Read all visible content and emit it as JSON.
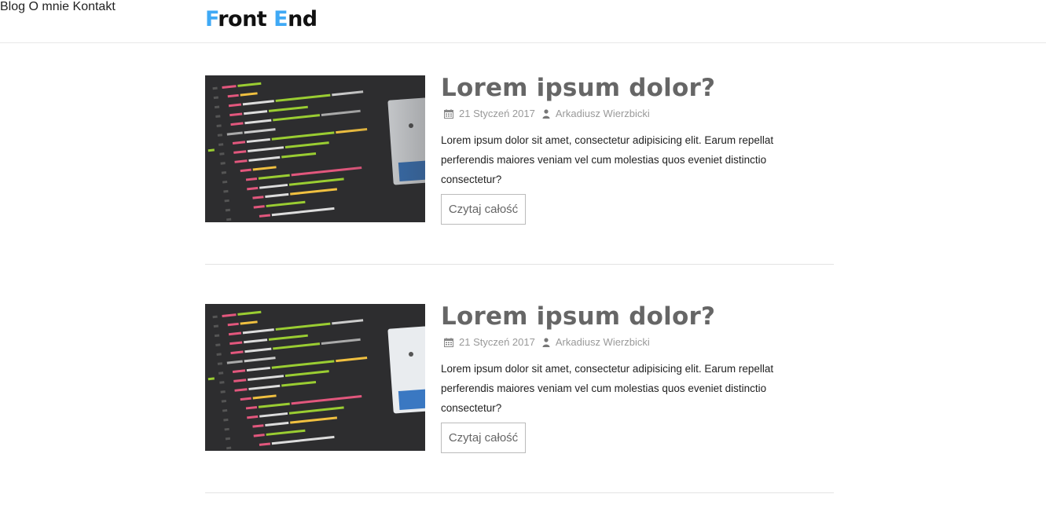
{
  "brand": {
    "logo_first_letter": "F",
    "logo_first_rest": "ront",
    "logo_second_letter": "E",
    "logo_second_rest": "nd",
    "accent_color": "#3fa9f5"
  },
  "nav": {
    "items": [
      {
        "label": "Blog"
      },
      {
        "label": "O mnie"
      },
      {
        "label": "Kontakt"
      }
    ]
  },
  "posts": [
    {
      "title": "Lorem ipsum dolor?",
      "date": "21 Styczeń 2017",
      "author": "Arkadiusz Wierzbicki",
      "excerpt": "Lorem ipsum dolor sit amet, consectetur adipisicing elit. Earum repellat perferendis maiores veniam vel cum molestias quos eveniet distinctio consectetur?",
      "read_more": "Czytaj całość",
      "image_icon": "code-screenshot-image"
    },
    {
      "title": "Lorem ipsum dolor?",
      "date": "21 Styczeń 2017",
      "author": "Arkadiusz Wierzbicki",
      "excerpt": "Lorem ipsum dolor sit amet, consectetur adipisicing elit. Earum repellat perferendis maiores veniam vel cum molestias quos eveniet distinctio consectetur?",
      "read_more": "Czytaj całość",
      "image_icon": "code-screenshot-image"
    }
  ],
  "icons": {
    "date": "calendar-icon",
    "author": "user-icon"
  }
}
